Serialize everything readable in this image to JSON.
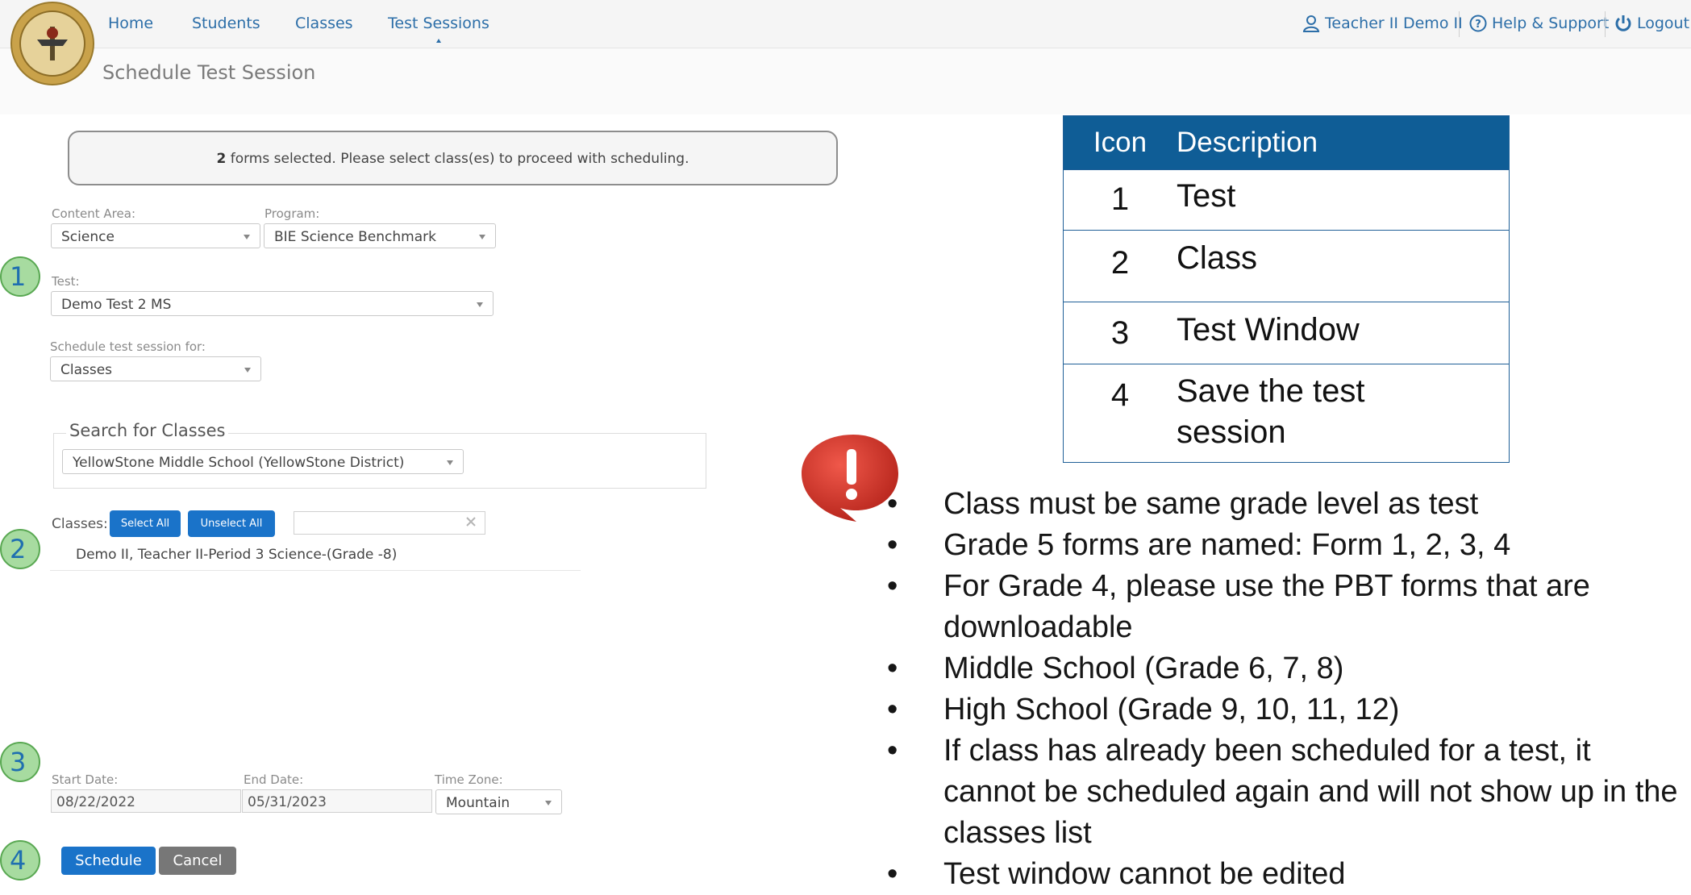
{
  "nav": {
    "items": [
      {
        "label": "Home"
      },
      {
        "label": "Students"
      },
      {
        "label": "Classes"
      },
      {
        "label": "Test Sessions",
        "active": true
      }
    ],
    "user_label": "Teacher II Demo II",
    "help_label": "Help & Support",
    "logout_label": "Logout"
  },
  "page": {
    "title": "Schedule Test Session"
  },
  "notice": {
    "count": "2",
    "text": " forms selected. Please select class(es) to proceed with scheduling."
  },
  "form": {
    "content_area": {
      "label": "Content Area:",
      "value": "Science"
    },
    "program": {
      "label": "Program:",
      "value": "BIE Science Benchmark"
    },
    "test": {
      "label": "Test:",
      "value": "Demo Test 2 MS"
    },
    "schedule_for": {
      "label": "Schedule test session for:",
      "value": "Classes"
    },
    "search": {
      "legend": "Search for Classes",
      "school_value": "YellowStone Middle School (YellowStone District)"
    },
    "classes": {
      "label": "Classes:",
      "select_all": "Select All",
      "unselect_all": "Unselect All",
      "filter_value": "",
      "items": [
        "Demo II, Teacher II-Period 3 Science-(Grade -8)"
      ]
    },
    "start_date": {
      "label": "Start Date:",
      "value": "08/22/2022"
    },
    "end_date": {
      "label": "End Date:",
      "value": "05/31/2023"
    },
    "time_zone": {
      "label": "Time Zone:",
      "value": "Mountain"
    },
    "schedule_button": "Schedule",
    "cancel_button": "Cancel"
  },
  "steps": [
    "1",
    "2",
    "3",
    "4"
  ],
  "legend_table": {
    "headers": [
      "Icon",
      "Description"
    ],
    "rows": [
      {
        "icon": "1",
        "description": "Test"
      },
      {
        "icon": "2",
        "description": "Class"
      },
      {
        "icon": "3",
        "description": "Test Window"
      },
      {
        "icon": "4",
        "description": "Save the test session"
      }
    ]
  },
  "notes": [
    "Class must be same grade level as test",
    "Grade 5 forms are named: Form 1, 2, 3, 4",
    "For Grade 4, please use the PBT forms that are downloadable",
    "Middle School (Grade 6, 7, 8)",
    "High School (Grade 9, 10, 11, 12)",
    "If class has already been scheduled for a test, it cannot be scheduled again and will not show up in the classes list",
    "Test window cannot be edited"
  ],
  "colors": {
    "accent": "#1a73c9",
    "table_header": "#0f5d96",
    "step_fill": "#a7dba0",
    "alert_red": "#d9362b"
  }
}
